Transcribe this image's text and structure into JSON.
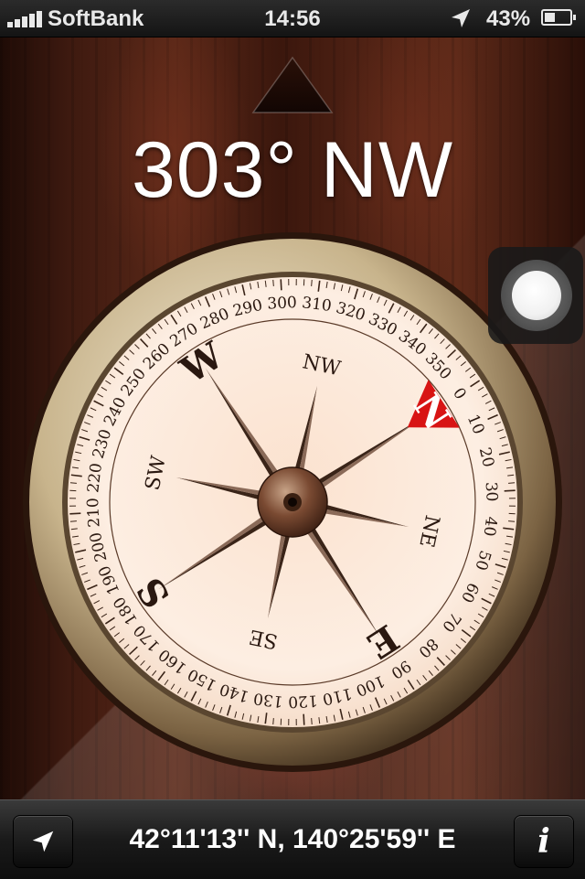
{
  "status_bar": {
    "carrier": "SoftBank",
    "time": "14:56",
    "battery_percent": "43%",
    "battery_level": 0.43,
    "icons": [
      "signal-bars-icon",
      "location-arrow-icon",
      "battery-icon"
    ]
  },
  "compass": {
    "heading_degrees": "303°",
    "heading_direction": "NW",
    "degree_labels": [
      "0",
      "10",
      "20",
      "30",
      "40",
      "50",
      "60",
      "70",
      "80",
      "90",
      "100",
      "110",
      "120",
      "130",
      "140",
      "150",
      "160",
      "170",
      "180",
      "190",
      "200",
      "210",
      "220",
      "230",
      "240",
      "250",
      "260",
      "270",
      "280",
      "290",
      "300",
      "310",
      "320",
      "330",
      "340",
      "350"
    ],
    "cardinals": {
      "north": "N",
      "east": "E",
      "south": "S",
      "west": "W"
    },
    "intercardinals": {
      "northeast": "NE",
      "southeast": "SE",
      "southwest": "SW",
      "northwest": "NW"
    },
    "colors": {
      "north_marker": "#d81414",
      "bezel": "#b8a37e",
      "dial": "#fbe6d6",
      "needle": "#3a2418"
    }
  },
  "bottom_bar": {
    "coordinates": "42°11'13'' N, 140°25'59'' E",
    "locate_button_icon": "location-arrow-icon",
    "info_button_label": "i"
  }
}
